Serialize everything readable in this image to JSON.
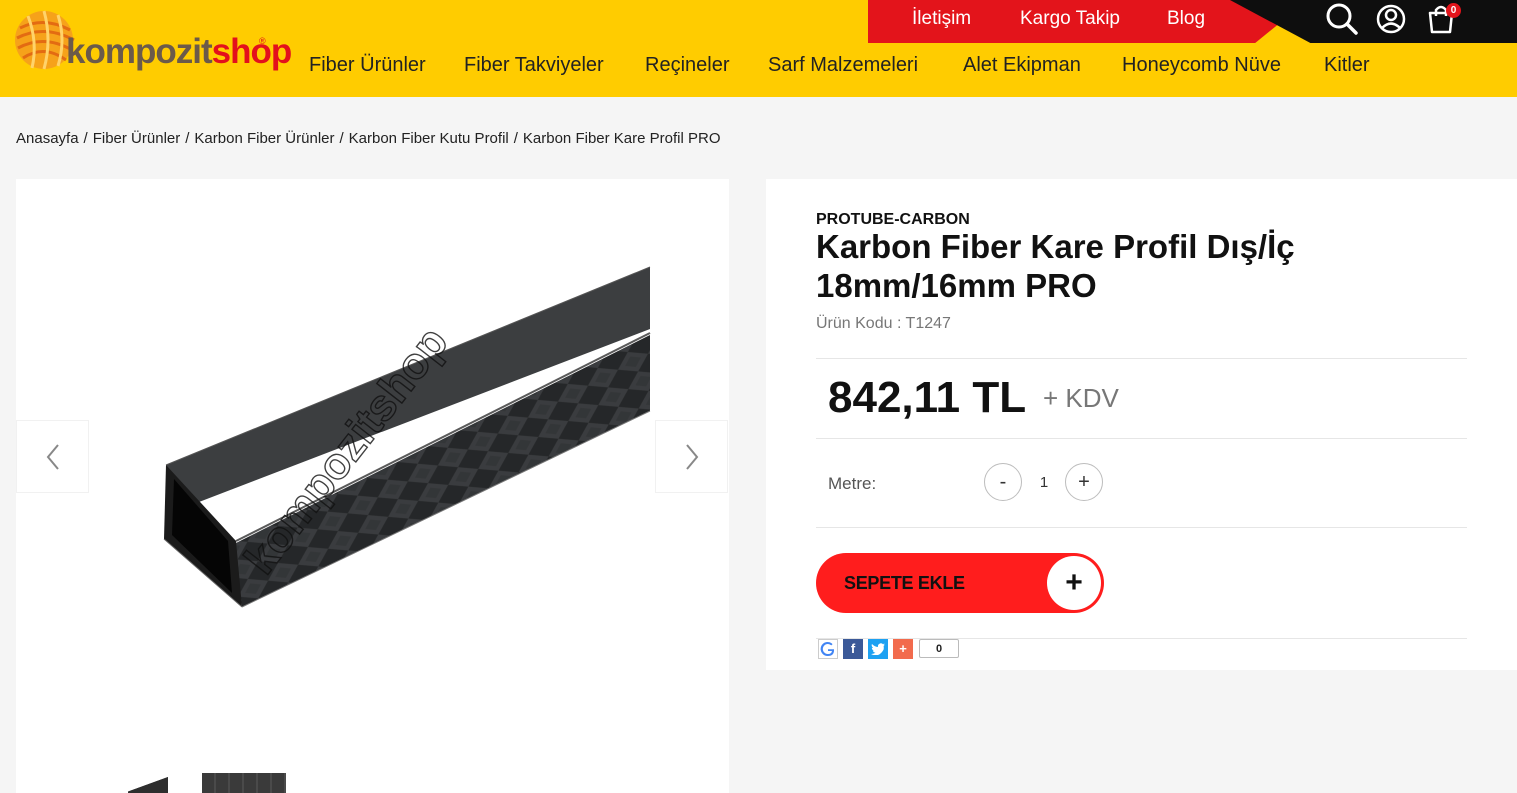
{
  "header": {
    "logo_text_1": "kompozit",
    "logo_text_2": "shop",
    "logo_reg": "®",
    "top_links": [
      "İletişim",
      "Kargo Takip",
      "Blog"
    ],
    "cart_count": "0",
    "icons": [
      "search-icon",
      "user-icon",
      "cart-icon"
    ]
  },
  "nav": {
    "items": [
      "Fiber Ürünler",
      "Fiber Takviyeler",
      "Reçineler",
      "Sarf Malzemeleri",
      "Alet Ekipman",
      "Honeycomb Nüve",
      "Kitler"
    ]
  },
  "breadcrumb": [
    "Anasayfa",
    "Fiber Ürünler",
    "Karbon Fiber Ürünler",
    "Karbon Fiber Kutu Profil",
    "Karbon Fiber Kare Profil PRO"
  ],
  "breadcrumb_sep": "/",
  "gallery": {
    "watermark": "kompozitshop",
    "prev_icon": "chevron-left-icon",
    "next_icon": "chevron-right-icon"
  },
  "product": {
    "brand": "PROTUBE-CARBON",
    "title": "Karbon Fiber Kare Profil Dış/İç 18mm/16mm PRO",
    "code_label": "Ürün Kodu : T1247",
    "price": "842,11 TL",
    "tax": "+ KDV",
    "qty_label": "Metre:",
    "qty_minus": "-",
    "qty_value": "1",
    "qty_plus": "+",
    "add_to_cart": "SEPETE EKLE",
    "add_to_cart_plus": "+",
    "share_count": "0"
  },
  "colors": {
    "header_yellow": "#ffcc00",
    "accent_red": "#e3141b",
    "cart_button_red": "#ff1d1d",
    "top_black": "#0e0e0e"
  }
}
